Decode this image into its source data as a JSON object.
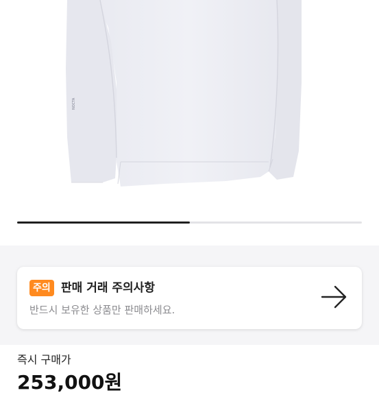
{
  "product_image": {
    "carousel_progress": 0.5
  },
  "notice": {
    "badge": "주의",
    "title": "판매 거래 주의사항",
    "description": "반드시 보유한 상품만 판매하세요."
  },
  "price": {
    "label": "즉시 구매가",
    "value": "253,000원"
  },
  "colors": {
    "badge_orange": "#ff8a1f",
    "progress_active": "#1f1f1f",
    "section_background": "#f5f5f7"
  },
  "icons": [
    "arrow-right-icon"
  ]
}
